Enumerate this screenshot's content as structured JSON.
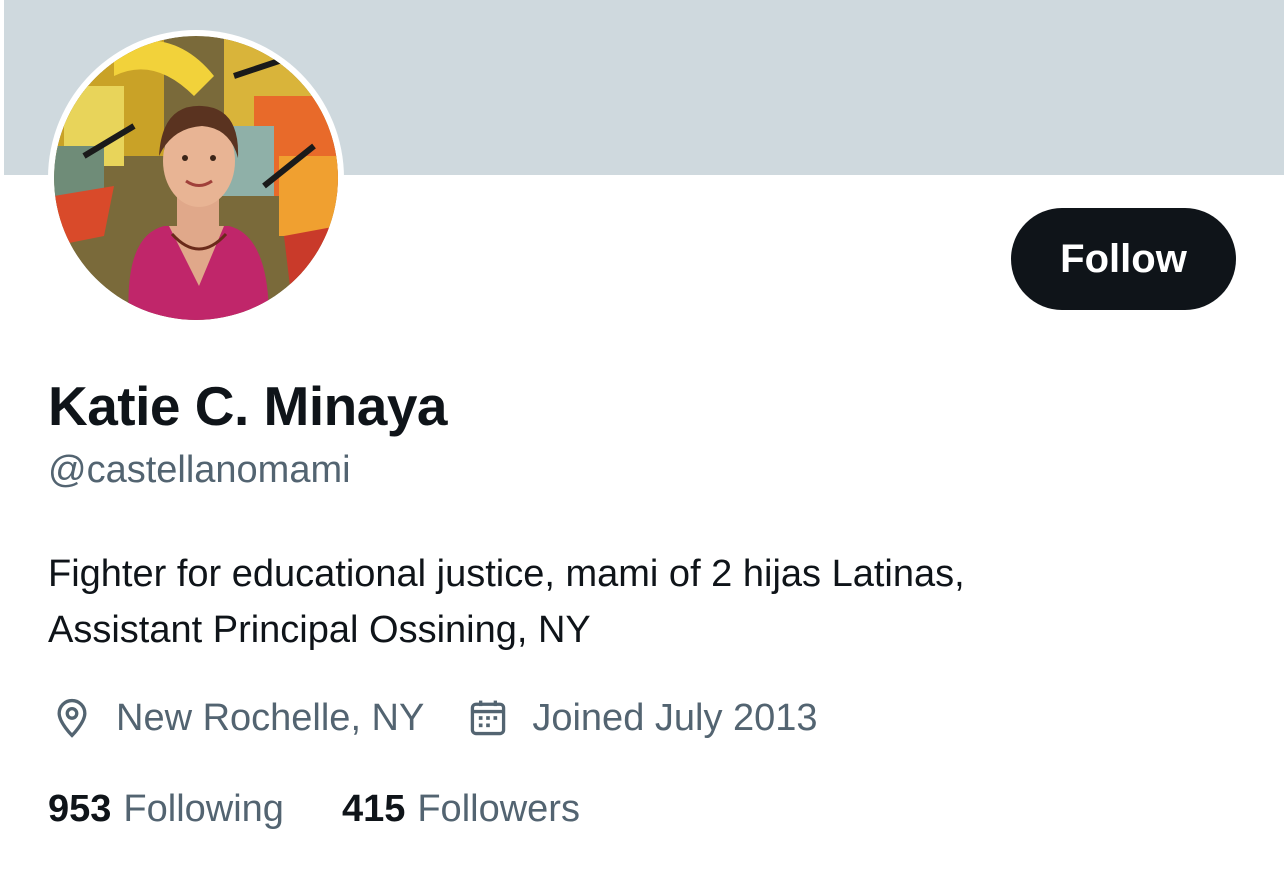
{
  "profile": {
    "name": "Katie C. Minaya",
    "handle": "@castellanomami",
    "bio_line1": "Fighter for educational justice, mami of 2 hijas Latinas,",
    "bio_line2": "Assistant Principal Ossining, NY",
    "location": "New Rochelle, NY",
    "joined": "Joined July 2013",
    "icons": {
      "location": "location-pin-icon",
      "joined": "calendar-icon"
    }
  },
  "actions": {
    "follow_label": "Follow"
  },
  "stats": {
    "following_count": "953",
    "following_label": "Following",
    "followers_count": "415",
    "followers_label": "Followers"
  },
  "colors": {
    "banner": "#cfd9de",
    "primary_text": "#0f1419",
    "secondary_text": "#536471",
    "button_bg": "#0f1419",
    "button_text": "#ffffff"
  }
}
